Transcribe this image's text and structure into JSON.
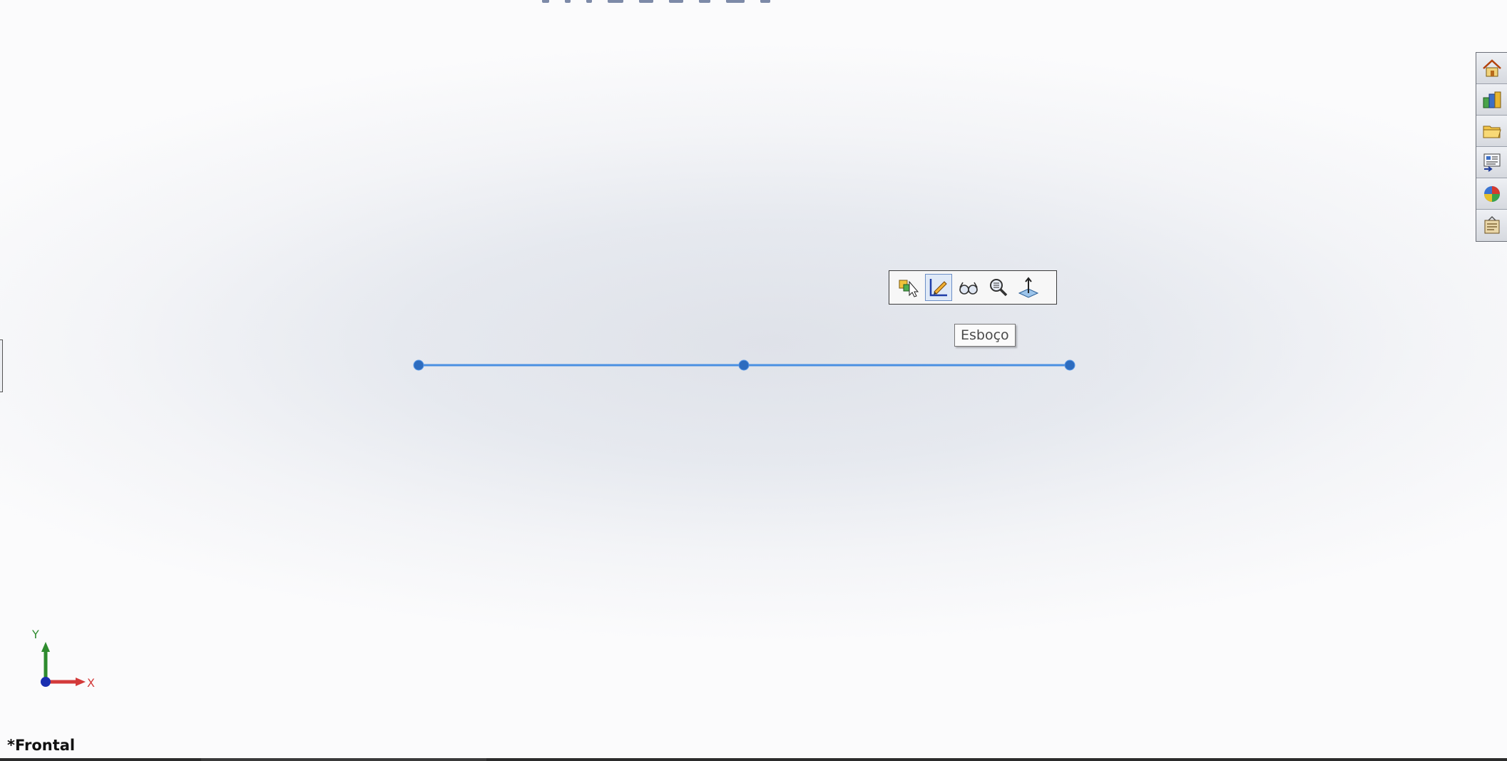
{
  "viewport": {
    "view_name": "*Frontal"
  },
  "context_toolbar": {
    "buttons": [
      {
        "icon": "select-sketch-icon"
      },
      {
        "icon": "edit-sketch-icon",
        "active": true
      },
      {
        "icon": "hide-show-icon"
      },
      {
        "icon": "zoom-to-selection-icon"
      },
      {
        "icon": "normal-to-icon"
      }
    ],
    "tooltip": "Esboço"
  },
  "task_pane": {
    "buttons": [
      "home-icon",
      "resources-icon",
      "design-library-icon",
      "file-explorer-icon",
      "appearances-icon",
      "custom-properties-icon"
    ]
  },
  "triad": {
    "y_label": "Y",
    "x_label": "X"
  },
  "colors": {
    "sketch_line": "#4a90e2",
    "sketch_point": "#2d6cbf",
    "y_axis": "#2e8b2e",
    "x_axis": "#d33a3a",
    "origin": "#1a2fb0"
  }
}
